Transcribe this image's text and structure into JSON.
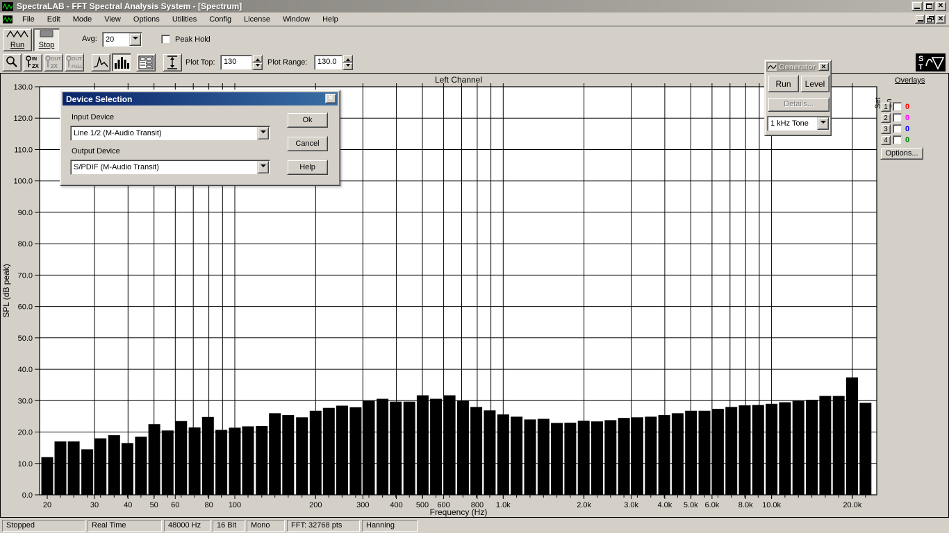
{
  "window": {
    "title": "SpectraLAB - FFT Spectral Analysis System - [Spectrum]"
  },
  "menu": {
    "items": [
      "File",
      "Edit",
      "Mode",
      "View",
      "Options",
      "Utilities",
      "Config",
      "License",
      "Window",
      "Help"
    ]
  },
  "icons": {
    "app-icon": "green-waveform-on-black",
    "run-icon": "zigzag-waveform",
    "stop-icon": "filled-rectangle",
    "magnifier-icon": "magnifying-glass",
    "line-spectrum-icon": "peak-curve",
    "bar-spectrum-icon": "vertical-bars",
    "display-options-icon": "form-window",
    "vertical-scale-icon": "double-arrow-range",
    "generator-icon": "sine-wave",
    "spectralab-logo": "s-t-sine-triangle"
  },
  "toolbar_main": {
    "run_label": "Run",
    "stop_label": "Stop",
    "avg_label": "Avg:",
    "avg_value": "20",
    "peak_hold_label": "Peak Hold",
    "peak_hold_checked": false
  },
  "toolbar_plot": {
    "zoom_in_line1": "IN",
    "zoom_in_line2": "2X",
    "zoom_out_line1": "OUT",
    "zoom_out_line2": "2X",
    "zoom_full_line1": "OUT",
    "zoom_full_line2": "FULL",
    "plot_top_label": "Plot Top:",
    "plot_top_value": "130",
    "plot_range_label": "Plot Range:",
    "plot_range_value": "130.0"
  },
  "device_dialog": {
    "title": "Device Selection",
    "input_device_label": "Input Device",
    "input_device_value": "Line 1/2 (M-Audio Transit)",
    "output_device_label": "Output Device",
    "output_device_value": "S/PDIF (M-Audio Transit)",
    "ok_label": "Ok",
    "cancel_label": "Cancel",
    "help_label": "Help"
  },
  "generator": {
    "title": "Generator",
    "run_label": "Run",
    "level_label": "Level",
    "details_label": "Details...",
    "signal_value": "1 kHz Tone"
  },
  "overlays": {
    "title": "Overlays",
    "col_set": "Set",
    "col_on": "On",
    "rows": [
      {
        "num": "1",
        "value": "0",
        "color": "#ff0000",
        "checked": false
      },
      {
        "num": "2",
        "value": "0",
        "color": "#ff00ff",
        "checked": false
      },
      {
        "num": "3",
        "value": "0",
        "color": "#0000ff",
        "checked": false
      },
      {
        "num": "4",
        "value": "0",
        "color": "#008000",
        "checked": false
      }
    ],
    "options_label": "Options..."
  },
  "chart_data": {
    "type": "bar",
    "title": "Left Channel",
    "xlabel": "Frequency (Hz)",
    "ylabel": "SPL (dB peak)",
    "x_scale": "log",
    "ylim": [
      0,
      130
    ],
    "y_tick_step": 10,
    "grid": "on",
    "bar_spacing": "1/6 octave",
    "x_tick_labels": [
      [
        20,
        "20"
      ],
      [
        30,
        "30"
      ],
      [
        40,
        "40"
      ],
      [
        50,
        "50"
      ],
      [
        60,
        "60"
      ],
      [
        80,
        "80"
      ],
      [
        100,
        "100"
      ],
      [
        200,
        "200"
      ],
      [
        300,
        "300"
      ],
      [
        400,
        "400"
      ],
      [
        500,
        "500"
      ],
      [
        600,
        "600"
      ],
      [
        800,
        "800"
      ],
      [
        1000,
        "1.0k"
      ],
      [
        2000,
        "2.0k"
      ],
      [
        3000,
        "3.0k"
      ],
      [
        4000,
        "4.0k"
      ],
      [
        5000,
        "5.0k"
      ],
      [
        6000,
        "6.0k"
      ],
      [
        8000,
        "8.0k"
      ],
      [
        10000,
        "10.0k"
      ],
      [
        20000,
        "20.0k"
      ]
    ],
    "grid_freqs_hz": [
      30,
      40,
      50,
      60,
      70,
      80,
      90,
      100,
      200,
      300,
      400,
      500,
      600,
      700,
      800,
      900,
      1000,
      2000,
      3000,
      4000,
      5000,
      6000,
      7000,
      8000,
      9000,
      10000,
      20000
    ],
    "freqs_hz": [
      20,
      22.4,
      25.1,
      28.2,
      31.6,
      35.5,
      39.8,
      44.7,
      50.1,
      56.2,
      63.1,
      70.8,
      79.4,
      89.1,
      100,
      112,
      126,
      141,
      158,
      178,
      200,
      224,
      251,
      282,
      316,
      355,
      398,
      447,
      501,
      562,
      631,
      708,
      794,
      891,
      1000,
      1122,
      1259,
      1413,
      1585,
      1778,
      1995,
      2239,
      2512,
      2818,
      3162,
      3548,
      3981,
      4467,
      5012,
      5623,
      6310,
      7079,
      7943,
      8913,
      10000,
      11220,
      12589,
      14125,
      15849,
      17783,
      19953,
      22387
    ],
    "values_db": [
      12,
      17,
      17,
      14.5,
      18,
      19,
      16.5,
      18.5,
      22.5,
      20.5,
      23.5,
      21.5,
      24.8,
      20.7,
      21.4,
      21.8,
      21.9,
      26,
      25.4,
      24.7,
      26.8,
      27.7,
      28.4,
      27.9,
      30,
      30.6,
      29.7,
      29.7,
      31.7,
      30.6,
      31.7,
      30,
      28,
      26.9,
      25.6,
      24.9,
      24,
      24.2,
      22.9,
      23,
      23.6,
      23.4,
      23.8,
      24.5,
      24.7,
      24.9,
      25.4,
      26,
      26.8,
      26.8,
      27.4,
      28,
      28.5,
      28.6,
      29,
      29.5,
      30,
      30.3,
      31.5,
      31.5,
      37.4,
      29.3
    ]
  },
  "statusbar": {
    "segments": [
      "Stopped",
      "Real Time",
      "48000 Hz",
      "16 Bit",
      "Mono",
      "FFT: 32768 pts",
      "Hanning"
    ]
  }
}
